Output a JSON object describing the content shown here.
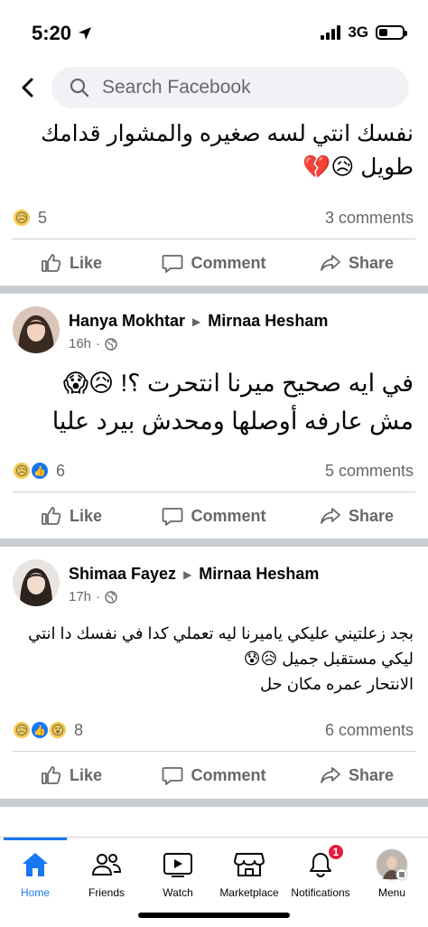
{
  "status_bar": {
    "time": "5:20",
    "network": "3G"
  },
  "search": {
    "placeholder": "Search Facebook"
  },
  "post0": {
    "text_lines": [
      "نفسك انتي لسه صغيره والمشوار قدامك",
      "طويل 😥💔"
    ],
    "reaction_count": "5",
    "comments": "3 comments"
  },
  "actions": {
    "like": "Like",
    "comment": "Comment",
    "share": "Share"
  },
  "post1": {
    "author": "Hanya Mokhtar",
    "target": "Mirnaa Hesham",
    "time": "16h",
    "text_lines": [
      "في ايه صحيح ميرنا انتحرت ؟! 😥😱",
      "مش عارفه أوصلها ومحدش بيرد عليا"
    ],
    "reaction_count": "6",
    "comments": "5 comments"
  },
  "post2": {
    "author": "Shimaa Fayez",
    "target": "Mirnaa Hesham",
    "time": "17h",
    "text_lines": [
      "بجد زعلتيني عليكي ياميرنا ليه تعملي كدا في نفسك  دا انتي",
      "ليكي مستقبل جميل 😥😰",
      "الانتحار عمره مكان حل"
    ],
    "reaction_count": "8",
    "comments": "6 comments"
  },
  "tabs": [
    {
      "label": "Home",
      "icon": "home-icon"
    },
    {
      "label": "Friends",
      "icon": "friends-icon"
    },
    {
      "label": "Watch",
      "icon": "watch-icon"
    },
    {
      "label": "Marketplace",
      "icon": "marketplace-icon"
    },
    {
      "label": "Notifications",
      "icon": "bell-icon",
      "badge": "1"
    },
    {
      "label": "Menu",
      "icon": "menu-avatar-icon"
    }
  ],
  "colors": {
    "accent": "#1877f2",
    "badge": "#e41e3f",
    "muted": "#65676b"
  }
}
